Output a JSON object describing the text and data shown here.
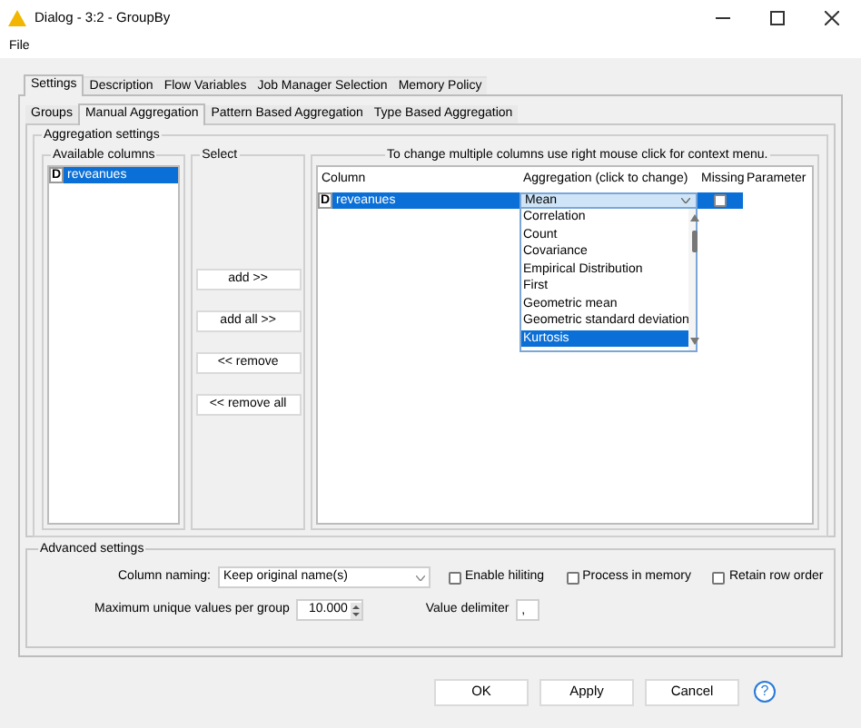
{
  "window": {
    "title": "Dialog - 3:2 - GroupBy"
  },
  "menu": [
    "File"
  ],
  "tabs": [
    {
      "label": "Settings",
      "selected": true
    },
    {
      "label": "Description",
      "selected": false
    },
    {
      "label": "Flow Variables",
      "selected": false
    },
    {
      "label": "Job Manager Selection",
      "selected": false
    },
    {
      "label": "Memory Policy",
      "selected": false
    }
  ],
  "sub_tabs": [
    {
      "label": "Groups",
      "selected": false
    },
    {
      "label": "Manual Aggregation",
      "selected": true
    },
    {
      "label": "Pattern Based Aggregation",
      "selected": false
    },
    {
      "label": "Type Based Aggregation",
      "selected": false
    }
  ],
  "aggregation_settings": {
    "title": "Aggregation settings",
    "available_columns": {
      "title": "Available columns",
      "items": [
        {
          "type": "D",
          "name": "reveanues",
          "selected": true
        }
      ]
    },
    "select": {
      "title": "Select",
      "buttons": [
        "add >>",
        "add all >>",
        "<< remove",
        "<< remove all"
      ]
    },
    "table": {
      "hint": "To change multiple columns use right mouse click for context menu.",
      "columns": [
        "Column",
        "Aggregation (click to change)",
        "Missing",
        "Parameter"
      ],
      "rows": [
        {
          "type": "D",
          "column": "reveanues",
          "aggregation": "Mean",
          "missing": false,
          "selected": true
        }
      ],
      "dropdown": [
        {
          "label": "Correlation",
          "selected": false
        },
        {
          "label": "Count",
          "selected": false
        },
        {
          "label": "Covariance",
          "selected": false
        },
        {
          "label": "Empirical Distribution",
          "selected": false
        },
        {
          "label": "First",
          "selected": false
        },
        {
          "label": "Geometric mean",
          "selected": false
        },
        {
          "label": "Geometric standard deviation",
          "selected": false
        },
        {
          "label": "Kurtosis",
          "selected": true
        }
      ]
    }
  },
  "advanced_settings": {
    "title": "Advanced settings",
    "column_naming": {
      "label": "Column naming:",
      "value": "Keep original name(s)"
    },
    "checkboxes": [
      {
        "label": "Enable hiliting",
        "checked": false
      },
      {
        "label": "Process in memory",
        "checked": false
      },
      {
        "label": "Retain row order",
        "checked": false
      }
    ],
    "max_unique": {
      "label": "Maximum unique values per group",
      "value": "10.000"
    },
    "value_delimiter": {
      "label": "Value delimiter",
      "value": ","
    }
  },
  "buttons": [
    "OK",
    "Apply",
    "Cancel"
  ],
  "help_button": "?"
}
